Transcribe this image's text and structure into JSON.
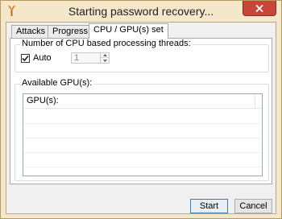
{
  "window": {
    "title": "Starting password recovery...",
    "icon": "app-key-icon",
    "close_icon": "close-icon"
  },
  "tabs": [
    {
      "label": "Attacks",
      "active": false
    },
    {
      "label": "Progress",
      "active": false
    },
    {
      "label": "CPU / GPU(s) set",
      "active": true
    }
  ],
  "cpu_group": {
    "legend": "Number of CPU based processing threads:",
    "auto_label": "Auto",
    "auto_checked": true,
    "threads_value": "1"
  },
  "gpu_group": {
    "legend": "Available GPU(s):",
    "column_header": "GPU(s):"
  },
  "buttons": {
    "start": "Start",
    "cancel": "Cancel"
  },
  "colors": {
    "frame": "#f5e7c9",
    "close_button": "#c7463a",
    "accent_border": "#3c7fb1"
  }
}
